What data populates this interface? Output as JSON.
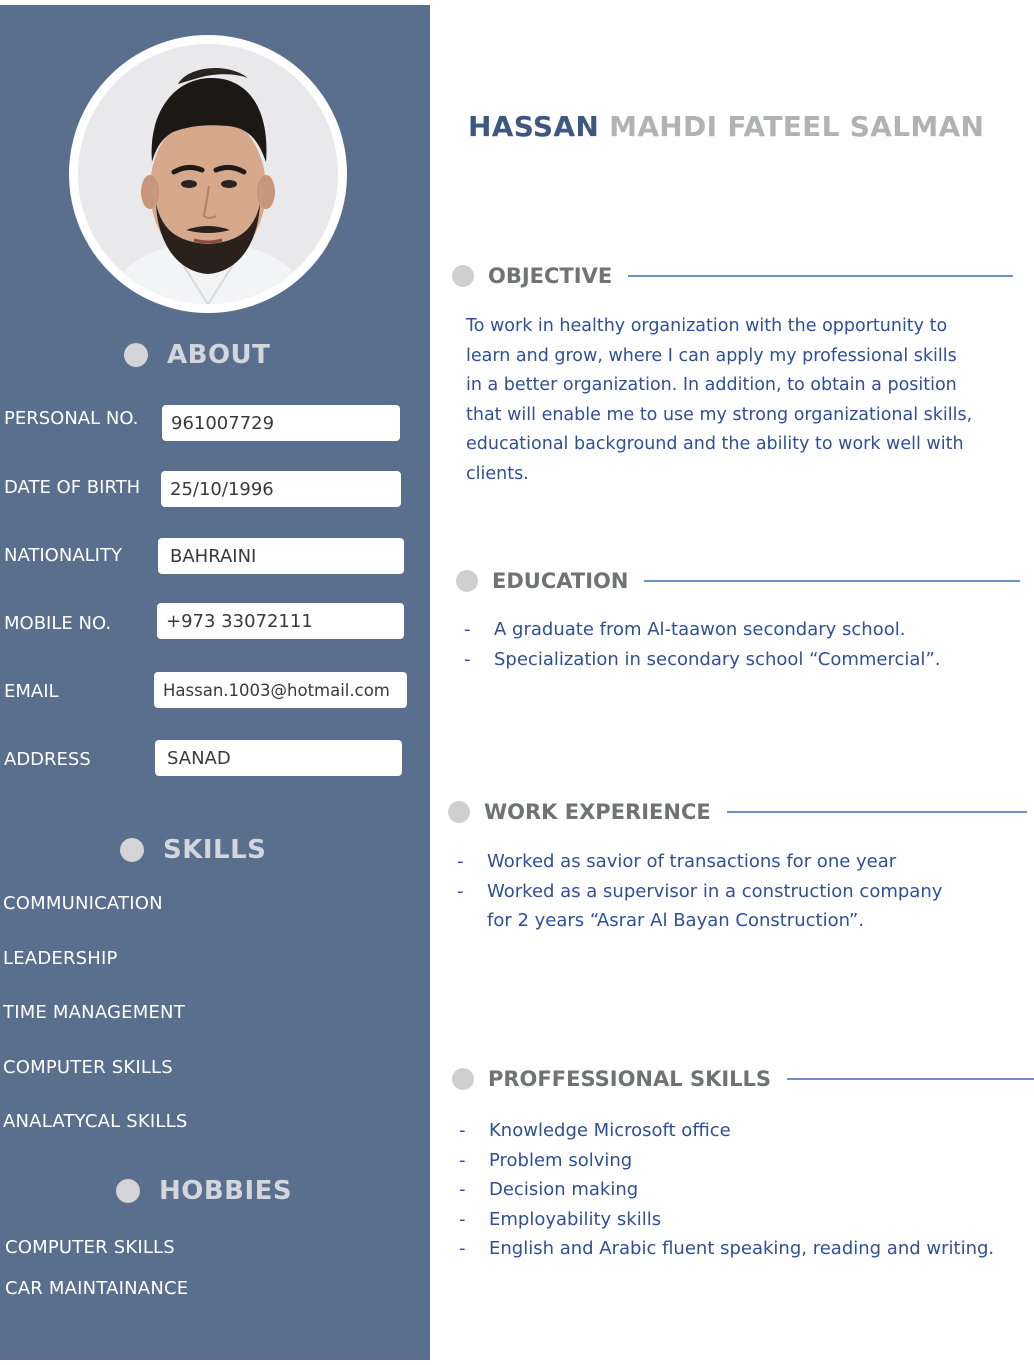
{
  "name": {
    "first": "HASSAN",
    "rest": "MAHDI FATEEL SALMAN"
  },
  "about": {
    "heading": "ABOUT",
    "fields": [
      {
        "label": "PERSONAL NO.",
        "value": "961007729"
      },
      {
        "label": "DATE OF BIRTH",
        "value": "25/10/1996"
      },
      {
        "label": "NATIONALITY",
        "value": "BAHRAINI"
      },
      {
        "label": "MOBILE NO.",
        "value": "+973 33072111"
      },
      {
        "label": "EMAIL",
        "value": "Hassan.1003@hotmail.com"
      },
      {
        "label": "ADDRESS",
        "value": "SANAD"
      }
    ]
  },
  "skills": {
    "heading": "SKILLS",
    "items": [
      "COMMUNICATION",
      "LEADERSHIP",
      "TIME MANAGEMENT",
      "COMPUTER SKILLS",
      "ANALATYCAL SKILLS"
    ]
  },
  "hobbies": {
    "heading": "HOBBIES",
    "items": [
      "COMPUTER SKILLS",
      "CAR MAINTAINANCE"
    ]
  },
  "objective": {
    "heading": "OBJECTIVE",
    "lines": [
      "To work in healthy organization with the opportunity to",
      "learn and grow, where I can apply my professional skills",
      "in a better organization. In addition, to obtain a position",
      "that will enable me to use my strong organizational skills,",
      "educational background and the ability to work well with",
      "clients."
    ]
  },
  "education": {
    "heading": "EDUCATION",
    "items": [
      "A graduate from Al-taawon secondary school.",
      "Specialization in secondary school “Commercial”."
    ]
  },
  "work": {
    "heading": "WORK EXPERIENCE",
    "items": [
      "Worked as savior of transactions for one year",
      "Worked as a supervisor in a construction company",
      "for 2 years “Asrar Al Bayan Construction”."
    ]
  },
  "professional": {
    "heading": "PROFFESSIONAL SKILLS",
    "items": [
      "Knowledge Microsoft office",
      "Problem solving",
      "Decision making",
      "Employability skills",
      "English and Arabic fluent speaking, reading and writing."
    ]
  },
  "bullet_char": "-",
  "colors": {
    "sidebar": "#5a6f8d",
    "accent_text": "#2f4f98",
    "name_first": "#3e577f",
    "name_rest": "#b0b2b6",
    "rule": "#6f8ec4"
  }
}
